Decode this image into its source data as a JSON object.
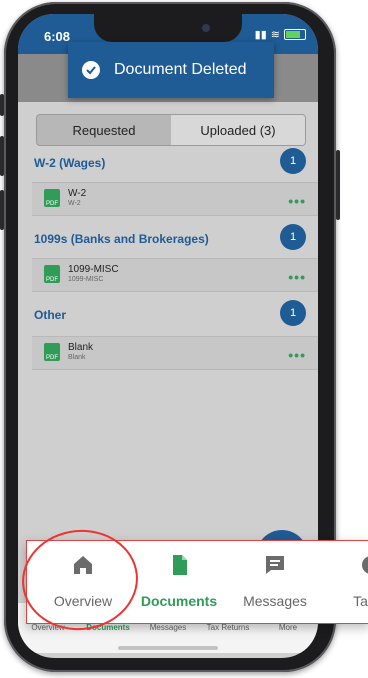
{
  "status": {
    "time": "6:08"
  },
  "toast": {
    "text": "Document Deleted"
  },
  "segments": {
    "left": "Requested",
    "right": "Uploaded (3)"
  },
  "sections": [
    {
      "title": "W-2 (Wages)",
      "count": "1",
      "row_title": "W-2",
      "row_sub": "W-2"
    },
    {
      "title": "1099s (Banks and Brokerages)",
      "count": "1",
      "row_title": "1099-MISC",
      "row_sub": "1099-MISC"
    },
    {
      "title": "Other",
      "count": "1",
      "row_title": "Blank",
      "row_sub": "Blank"
    }
  ],
  "pdf_label": "PDF",
  "tabbar": {
    "items": [
      "Overview",
      "Documents",
      "Messages",
      "Tax Returns",
      "More"
    ]
  },
  "zoom": {
    "items": [
      "Overview",
      "Documents",
      "Messages",
      "Tax R"
    ]
  },
  "colors": {
    "brand_blue": "#1f5b94",
    "accent_green": "#2f9c58",
    "highlight_red": "#e33333"
  }
}
